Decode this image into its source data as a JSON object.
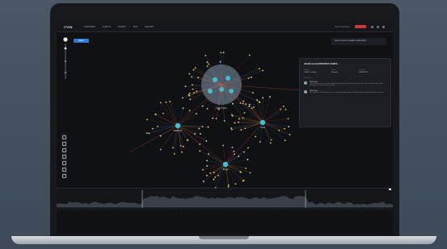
{
  "app": {
    "logo": "iTON"
  },
  "menu": [
    "OVERVIEW",
    "ALERTS",
    "ASSETS",
    "MAP",
    "REPORT"
  ],
  "topbar": {
    "workspace": "Segment Explorer"
  },
  "filter_tag": "Filters",
  "filter_bar": "Select a view to visualize relationships",
  "panel": {
    "title": "u8eZ9cuse4aJu8FFk8NLFmAMFk...",
    "fields": [
      {
        "label": "Identifier",
        "value": "3.4kB / Loading"
      },
      {
        "label": "Status",
        "value": "Analysis"
      },
      {
        "label": "Last Seen",
        "value": "04/05/2023"
      }
    ],
    "section": "Comments",
    "events": [
      {
        "title": "1654 Toolt",
        "text": "Lorem ipsum dolor sit amet, consectetur adipiscing elit. Integer nec odio. Praesent libero. Sed cursus ante dapibus diam. Sed nisi. Nulla quis sem at nibh elementum imperdiet."
      },
      {
        "title": "1654 Toolt",
        "text": "Duis sagittis ipsum. Praesent mauris. Fusce nec tellus sed augue semper porta. Mauris massa. Vestibulum lacinia arcu eget nulla."
      }
    ]
  },
  "nodes": {
    "hub": "Unit N.Cluc",
    "left": "Endpoint",
    "right": "Host",
    "bottom": "Target"
  },
  "colors": {
    "accent": "#2f7fd6",
    "edge_warn": "#d6883a",
    "edge_alert": "#c93a3a",
    "node": "#e8d36a",
    "hub": "#3ac4d6"
  }
}
